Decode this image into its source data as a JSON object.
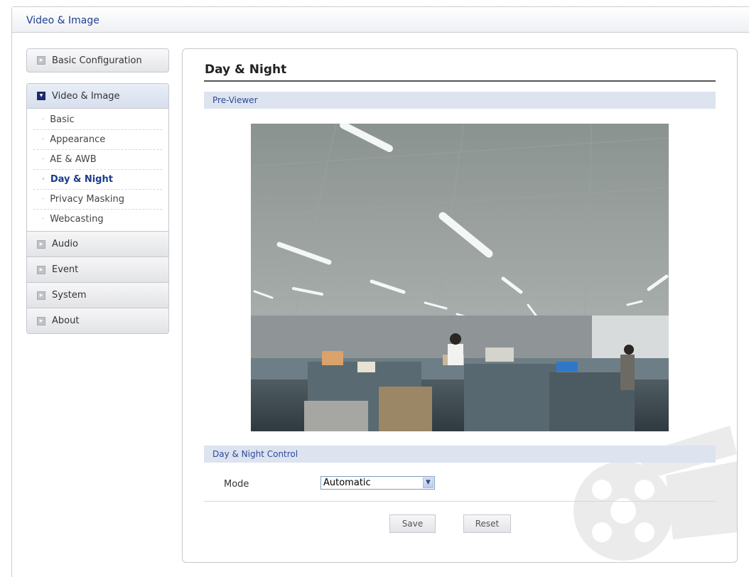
{
  "window": {
    "title": "Video & Image"
  },
  "sidebar": {
    "basic_configuration": "Basic Configuration",
    "video_image": {
      "label": "Video & Image",
      "items": [
        {
          "label": "Basic"
        },
        {
          "label": "Appearance"
        },
        {
          "label": "AE & AWB"
        },
        {
          "label": "Day & Night",
          "active": true
        },
        {
          "label": "Privacy Masking"
        },
        {
          "label": "Webcasting"
        }
      ]
    },
    "others": [
      {
        "label": "Audio"
      },
      {
        "label": "Event"
      },
      {
        "label": "System"
      },
      {
        "label": "About"
      }
    ]
  },
  "main": {
    "title": "Day & Night",
    "preview_section": "Pre-Viewer",
    "control_section": "Day & Night Control",
    "mode_label": "Mode",
    "mode_value": "Automatic",
    "save_label": "Save",
    "reset_label": "Reset"
  },
  "colors": {
    "accent": "#1f3e8f",
    "section_bar": "#dde3ef"
  }
}
